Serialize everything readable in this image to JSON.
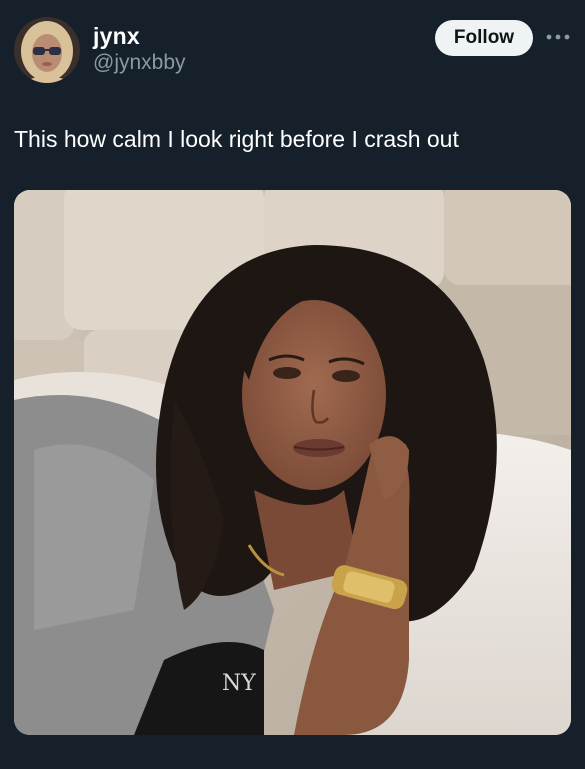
{
  "tweet": {
    "author": {
      "display_name": "jynx",
      "handle": "@jynxbby",
      "avatar_icon": "profile-avatar"
    },
    "follow_label": "Follow",
    "more_icon": "more-horizontal-icon",
    "text": "This how calm I look right before I crash out",
    "media": {
      "description_icon": "photo",
      "accent_colors": {
        "headboard": "#d8cfc3",
        "pillow": "#eeeae6",
        "hair": "#1f1714",
        "skin": "#8a5a45",
        "shirt": "#8f8f8f",
        "watch": "#c9a24a"
      }
    }
  },
  "theme": {
    "background": "#15202b",
    "text_primary": "#ffffff",
    "text_secondary": "#8b98a5",
    "button_bg": "#eff3f4",
    "button_text": "#0f1419"
  }
}
